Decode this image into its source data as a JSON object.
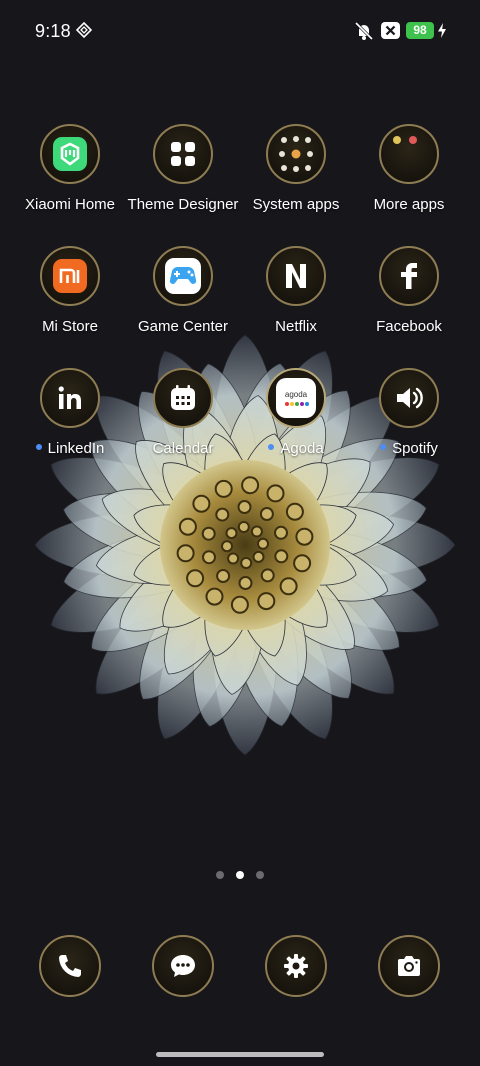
{
  "status": {
    "time": "9:18",
    "battery": "98"
  },
  "apps": [
    {
      "label": "Xiaomi Home",
      "icon": "xiaomi-home-icon"
    },
    {
      "label": "Theme Designer",
      "icon": "grid-icon"
    },
    {
      "label": "System apps",
      "icon": "folder-icon"
    },
    {
      "label": "More apps",
      "icon": "folder-icon"
    },
    {
      "label": "Mi Store",
      "icon": "mi-logo-icon"
    },
    {
      "label": "Game Center",
      "icon": "gamepad-icon"
    },
    {
      "label": "Netflix",
      "icon": "netflix-icon"
    },
    {
      "label": "Facebook",
      "icon": "facebook-icon"
    },
    {
      "label": "LinkedIn",
      "icon": "linkedin-icon",
      "new": true
    },
    {
      "label": "Calendar",
      "icon": "calendar-icon"
    },
    {
      "label": "Agoda",
      "icon": "agoda-icon",
      "new": true
    },
    {
      "label": "Spotify",
      "icon": "speaker-icon",
      "new": true
    }
  ],
  "agoda_logo_text": "agoda",
  "dock": [
    {
      "icon": "phone-icon"
    },
    {
      "icon": "messages-icon"
    },
    {
      "icon": "settings-icon"
    },
    {
      "icon": "camera-icon"
    }
  ],
  "pages": {
    "count": 3,
    "current": 2
  }
}
